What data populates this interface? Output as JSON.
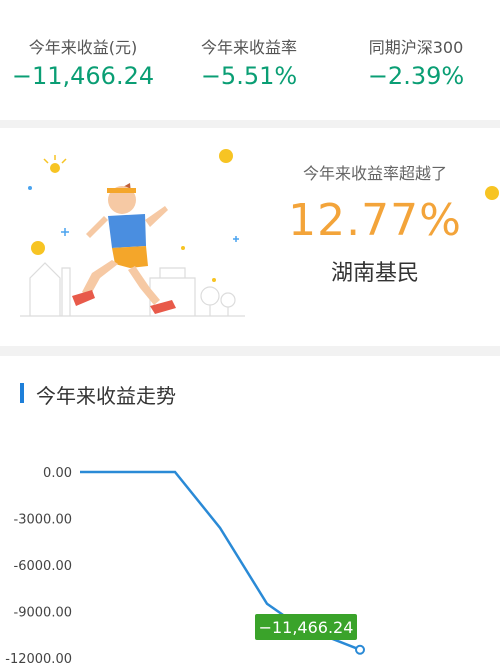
{
  "stats": [
    {
      "label": "今年来收益(元)",
      "value": "−11,466.24"
    },
    {
      "label": "今年来收益率",
      "value": "−5.51%"
    },
    {
      "label": "同期沪深300",
      "value": "−2.39%"
    }
  ],
  "promo": {
    "subtitle": "今年来收益率超越了",
    "percent": "12.77%",
    "region": "湖南基民"
  },
  "trend": {
    "title": "今年来收益走势"
  },
  "colors": {
    "negative": "#0a9e74",
    "accent": "#f3a43a",
    "line": "#2a8ad6",
    "tooltip": "#3aa32a"
  },
  "chart_data": {
    "type": "line",
    "yticks": [
      "0.00",
      "-3000.00",
      "-6000.00",
      "-9000.00",
      "-12000.00"
    ],
    "ylim": [
      -12000,
      0
    ],
    "series": [
      {
        "values": [
          0,
          0,
          -3600,
          -8500,
          -9900,
          -11466.24
        ]
      }
    ],
    "tooltip": "−11,466.24"
  }
}
